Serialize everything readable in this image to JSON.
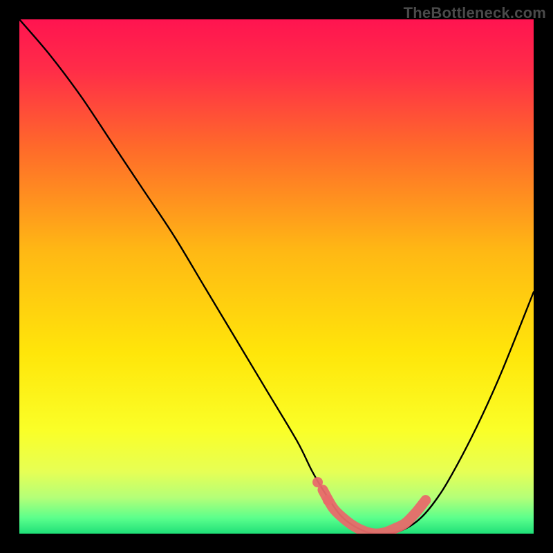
{
  "watermark": "TheBottleneck.com",
  "chart_data": {
    "type": "line",
    "title": "",
    "xlabel": "",
    "ylabel": "",
    "xlim": [
      0,
      100
    ],
    "ylim": [
      0,
      100
    ],
    "grid": false,
    "legend": false,
    "series": [
      {
        "name": "bottleneck-curve",
        "x": [
          0,
          6,
          12,
          18,
          24,
          30,
          36,
          42,
          48,
          54,
          57,
          60,
          63,
          67,
          70,
          74,
          78,
          82,
          86,
          90,
          94,
          100
        ],
        "y": [
          100,
          93,
          85,
          76,
          67,
          58,
          48,
          38,
          28,
          18,
          12,
          7,
          3,
          0.5,
          0,
          0.5,
          3,
          8,
          15,
          23,
          32,
          47
        ]
      }
    ],
    "highlight": {
      "name": "optimal-range",
      "x": [
        59,
        61,
        63,
        65,
        67,
        69,
        71,
        73,
        75,
        77,
        79
      ],
      "y": [
        8.5,
        5,
        3,
        1.5,
        0.5,
        0,
        0.2,
        1,
        2,
        4,
        6.5
      ]
    },
    "gradient_stops": [
      {
        "offset": 0.0,
        "color": "#ff1450"
      },
      {
        "offset": 0.1,
        "color": "#ff2d48"
      },
      {
        "offset": 0.25,
        "color": "#ff6a2a"
      },
      {
        "offset": 0.45,
        "color": "#ffb814"
      },
      {
        "offset": 0.65,
        "color": "#ffe60a"
      },
      {
        "offset": 0.8,
        "color": "#faff28"
      },
      {
        "offset": 0.88,
        "color": "#e6ff55"
      },
      {
        "offset": 0.93,
        "color": "#b4ff78"
      },
      {
        "offset": 0.97,
        "color": "#5aff8c"
      },
      {
        "offset": 1.0,
        "color": "#1fe078"
      }
    ],
    "highlight_color": "#e86a6a",
    "curve_color": "#000000"
  }
}
